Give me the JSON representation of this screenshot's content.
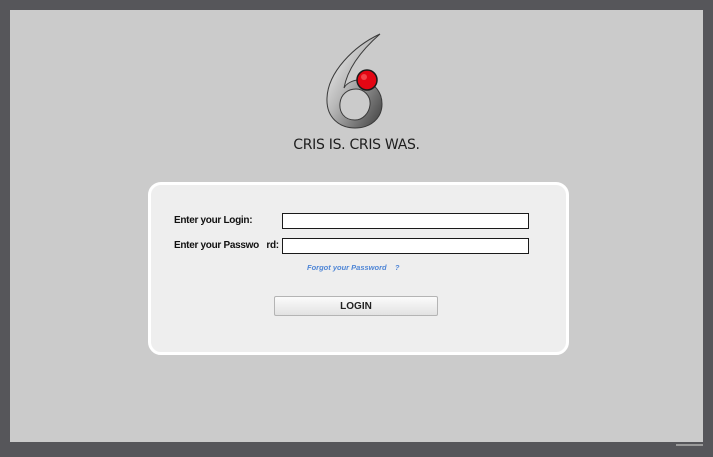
{
  "branding": {
    "logo_icon": "cris-logo-icon",
    "tagline": "CRIS IS. CRIS WAS."
  },
  "login_form": {
    "login_label": "Enter your Login:",
    "login_value": "",
    "password_label": "Enter your Passwo   rd:",
    "password_value": "",
    "forgot_link": "Forgot your Password    ?",
    "login_button": "LOGIN"
  },
  "colors": {
    "frame": "#56565a",
    "page_background": "#cbcbcb",
    "card_background": "#eeeeee",
    "link": "#4f86d6",
    "logo_dot": "#e30613"
  }
}
